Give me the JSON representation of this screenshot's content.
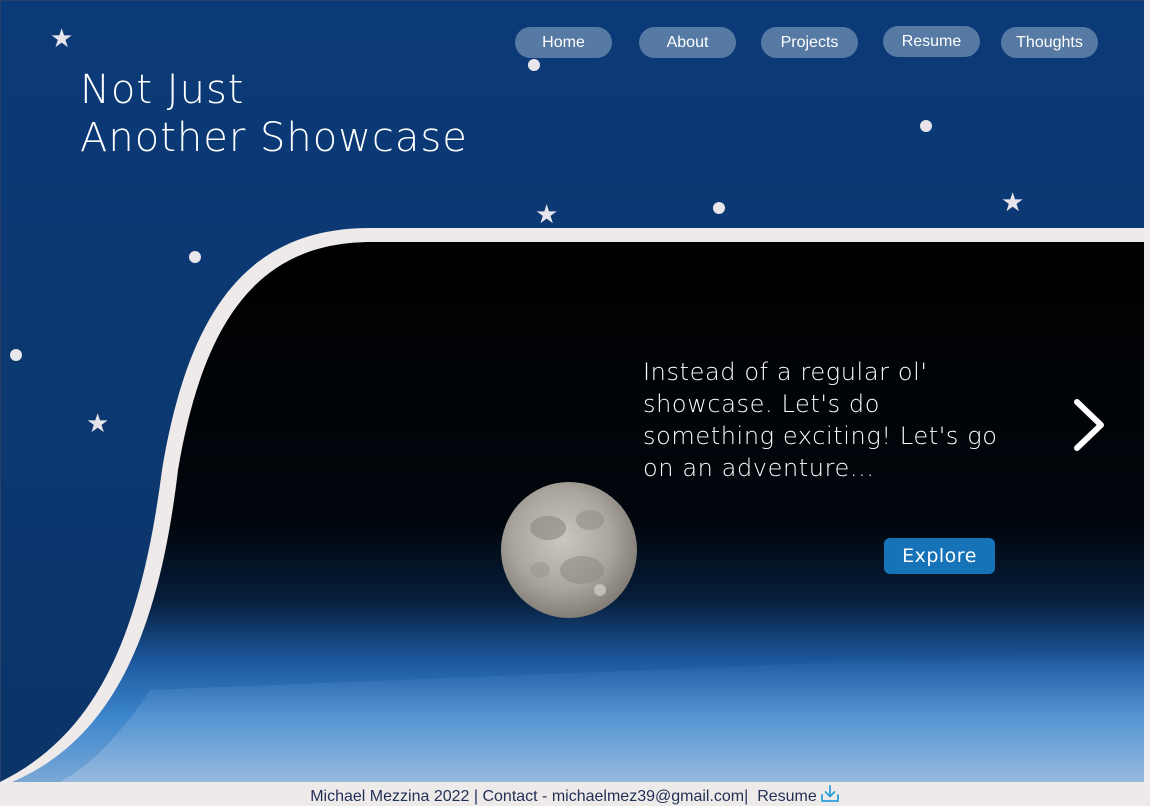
{
  "site": {
    "title_line1": "Not Just",
    "title_line2": "Another Showcase"
  },
  "nav": {
    "items": [
      {
        "label": "Home"
      },
      {
        "label": "About"
      },
      {
        "label": "Projects"
      },
      {
        "label": "Resume"
      },
      {
        "label": "Thoughts"
      }
    ]
  },
  "hero": {
    "text": "Instead of a regular ol' showcase. Let's do something exciting! Let's go on an adventure...",
    "explore_label": "Explore",
    "next_icon": "chevron-right-icon"
  },
  "footer": {
    "credit": "Michael Mezzina 2022",
    "separator1": " | ",
    "contact": "Contact - michaelmez39@gmail.com",
    "separator2": "|  ",
    "resume_label": "Resume",
    "resume_icon": "download-icon"
  },
  "colors": {
    "navy": "#0b3a78",
    "accent_button": "#1673b8",
    "nav_pill": "#6d8aa9",
    "footer_bg": "#efeaea"
  }
}
